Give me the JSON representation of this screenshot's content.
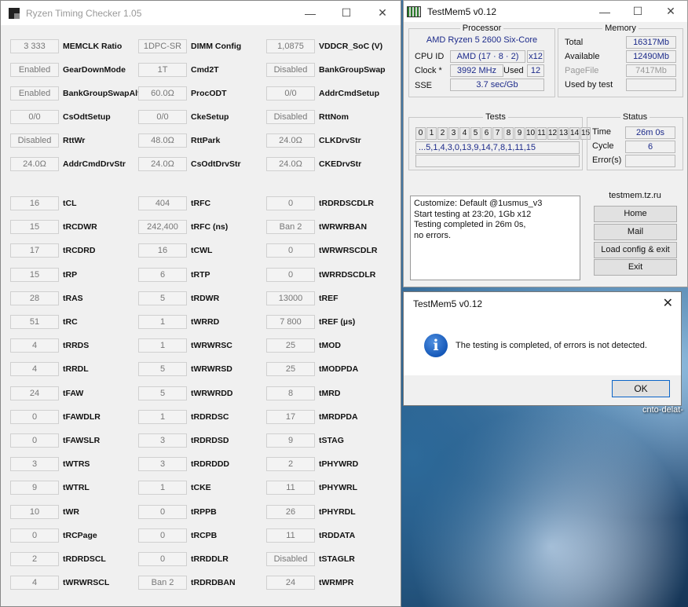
{
  "desktop": {
    "text": "cnto-delat-"
  },
  "rtc": {
    "title": "Ryzen Timing Checker 1.05",
    "controls": {
      "minimize": "—",
      "maximize": "☐",
      "close": "✕"
    },
    "col1": [
      {
        "value": "3 333",
        "label": "MEMCLK Ratio"
      },
      {
        "value": "Enabled",
        "label": "GearDownMode"
      },
      {
        "value": "Enabled",
        "label": "BankGroupSwapAlt"
      },
      {
        "value": "0/0",
        "label": "CsOdtSetup"
      },
      {
        "value": "Disabled",
        "label": "RttWr"
      },
      {
        "value": "24.0Ω",
        "label": "AddrCmdDrvStr"
      }
    ],
    "col2": [
      {
        "value": "1DPC-SR",
        "label": "DIMM Config"
      },
      {
        "value": "1T",
        "label": "Cmd2T"
      },
      {
        "value": "60.0Ω",
        "label": "ProcODT"
      },
      {
        "value": "0/0",
        "label": "CkeSetup"
      },
      {
        "value": "48.0Ω",
        "label": "RttPark"
      },
      {
        "value": "24.0Ω",
        "label": "CsOdtDrvStr"
      }
    ],
    "col3": [
      {
        "value": "1,0875",
        "label": "VDDCR_SoC (V)"
      },
      {
        "value": "Disabled",
        "label": "BankGroupSwap"
      },
      {
        "value": "0/0",
        "label": "AddrCmdSetup"
      },
      {
        "value": "Disabled",
        "label": "RttNom"
      },
      {
        "value": "24.0Ω",
        "label": "CLKDrvStr"
      },
      {
        "value": "24.0Ω",
        "label": "CKEDrvStr"
      }
    ],
    "t1": [
      {
        "value": "16",
        "label": "tCL"
      },
      {
        "value": "15",
        "label": "tRCDWR"
      },
      {
        "value": "17",
        "label": "tRCDRD"
      },
      {
        "value": "15",
        "label": "tRP"
      },
      {
        "value": "28",
        "label": "tRAS"
      },
      {
        "value": "51",
        "label": "tRC"
      },
      {
        "value": "4",
        "label": "tRRDS"
      },
      {
        "value": "4",
        "label": "tRRDL"
      },
      {
        "value": "24",
        "label": "tFAW"
      },
      {
        "value": "0",
        "label": "tFAWDLR"
      },
      {
        "value": "0",
        "label": "tFAWSLR"
      },
      {
        "value": "3",
        "label": "tWTRS"
      },
      {
        "value": "9",
        "label": "tWTRL"
      },
      {
        "value": "10",
        "label": "tWR"
      },
      {
        "value": "0",
        "label": "tRCPage"
      },
      {
        "value": "2",
        "label": "tRDRDSCL"
      },
      {
        "value": "4",
        "label": "tWRWRSCL"
      }
    ],
    "t2": [
      {
        "value": "404",
        "label": "tRFC"
      },
      {
        "value": "242,400",
        "label": "tRFC (ns)"
      },
      {
        "value": "16",
        "label": "tCWL"
      },
      {
        "value": "6",
        "label": "tRTP"
      },
      {
        "value": "5",
        "label": "tRDWR"
      },
      {
        "value": "1",
        "label": "tWRRD"
      },
      {
        "value": "1",
        "label": "tWRWRSC"
      },
      {
        "value": "5",
        "label": "tWRWRSD"
      },
      {
        "value": "5",
        "label": "tWRWRDD"
      },
      {
        "value": "1",
        "label": "tRDRDSC"
      },
      {
        "value": "3",
        "label": "tRDRDSD"
      },
      {
        "value": "3",
        "label": "tRDRDDD"
      },
      {
        "value": "1",
        "label": "tCKE"
      },
      {
        "value": "0",
        "label": "tRPPB"
      },
      {
        "value": "0",
        "label": "tRCPB"
      },
      {
        "value": "0",
        "label": "tRRDDLR"
      },
      {
        "value": "Ban 2",
        "label": "tRDRDBAN"
      }
    ],
    "t3": [
      {
        "value": "0",
        "label": "tRDRDSCDLR"
      },
      {
        "value": "Ban 2",
        "label": "tWRWRBAN"
      },
      {
        "value": "0",
        "label": "tWRWRSCDLR"
      },
      {
        "value": "0",
        "label": "tWRRDSCDLR"
      },
      {
        "value": "13000",
        "label": "tREF"
      },
      {
        "value": "7 800",
        "label": "tREF (µs)"
      },
      {
        "value": "25",
        "label": "tMOD"
      },
      {
        "value": "25",
        "label": "tMODPDA"
      },
      {
        "value": "8",
        "label": "tMRD"
      },
      {
        "value": "17",
        "label": "tMRDPDA"
      },
      {
        "value": "9",
        "label": "tSTAG"
      },
      {
        "value": "2",
        "label": "tPHYWRD"
      },
      {
        "value": "11",
        "label": "tPHYWRL"
      },
      {
        "value": "26",
        "label": "tPHYRDL"
      },
      {
        "value": "11",
        "label": "tRDDATA"
      },
      {
        "value": "Disabled",
        "label": "tSTAGLR"
      },
      {
        "value": "24",
        "label": "tWRMPR"
      }
    ]
  },
  "testmem": {
    "title": "TestMem5 v0.12",
    "controls": {
      "minimize": "—",
      "maximize": "☐",
      "close": "✕"
    },
    "processor": {
      "title": "Processor",
      "name": "AMD Ryzen 5 2600 Six-Core",
      "cpu_id_label": "CPU ID",
      "cpu_id": "AMD  (17 · 8 · 2)",
      "threads": "x12",
      "clock_label": "Clock *",
      "clock": "3992 MHz",
      "used_label": "Used",
      "used": "12",
      "sse_label": "SSE",
      "sse": "3.7 sec/Gb"
    },
    "memory": {
      "title": "Memory",
      "total_label": "Total",
      "total": "16317Mb",
      "available_label": "Available",
      "available": "12490Mb",
      "pagefile_label": "PageFile",
      "pagefile": "7417Mb",
      "used_by_test_label": "Used by test",
      "used_by_test": ""
    },
    "tests": {
      "title": "Tests",
      "cells": [
        "0",
        "1",
        "2",
        "3",
        "4",
        "5",
        "6",
        "7",
        "8",
        "9",
        "10",
        "11",
        "12",
        "13",
        "14",
        "15"
      ],
      "sequence": "...5,1,4,3,0,13,9,14,7,8,1,11,15"
    },
    "status": {
      "title": "Status",
      "time_label": "Time",
      "time": "26m 0s",
      "cycle_label": "Cycle",
      "cycle": "6",
      "errors_label": "Error(s)",
      "errors": ""
    },
    "log": [
      "Customize: Default @1usmus_v3",
      "Start testing at 23:20, 1Gb x12",
      "Testing completed in 26m 0s,",
      "no errors."
    ],
    "links": {
      "title": "testmem.tz.ru",
      "home": "Home",
      "mail": "Mail",
      "load_config": "Load config & exit",
      "exit": "Exit"
    }
  },
  "dialog": {
    "title": "TestMem5 v0.12",
    "close": "✕",
    "icon": "i",
    "message": "The testing is completed, of errors is not detected.",
    "ok": "OK"
  }
}
